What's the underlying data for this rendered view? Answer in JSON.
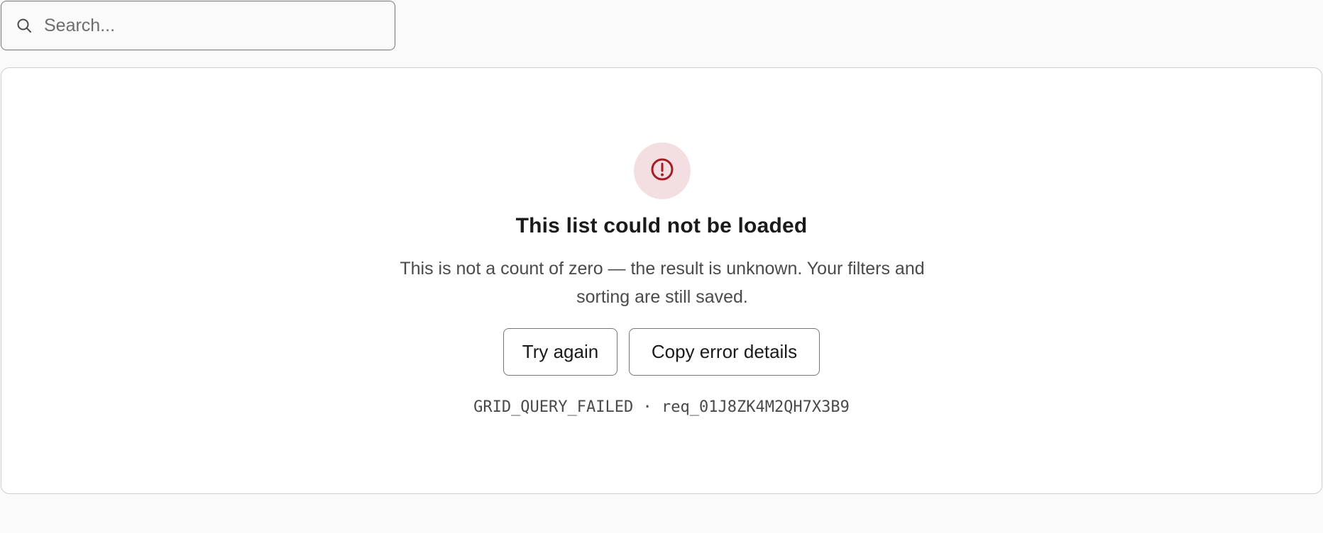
{
  "search": {
    "placeholder": "Search...",
    "value": "",
    "icon": "search-icon"
  },
  "error_state": {
    "icon": "alert-circle-icon",
    "title": "This list could not be loaded",
    "message": "This is not a count of zero — the result is unknown. Your filters and sorting are still saved.",
    "actions": {
      "retry_label": "Try again",
      "copy_label": "Copy error details"
    },
    "error_code": "GRID_QUERY_FAILED",
    "separator": "·",
    "request_id": "req_01J8ZK4M2QH7X3B9"
  },
  "colors": {
    "alert_icon": "#a51d24",
    "alert_background": "#f3dfe1",
    "border": "#767676",
    "panel_border": "#cfcfcf"
  }
}
